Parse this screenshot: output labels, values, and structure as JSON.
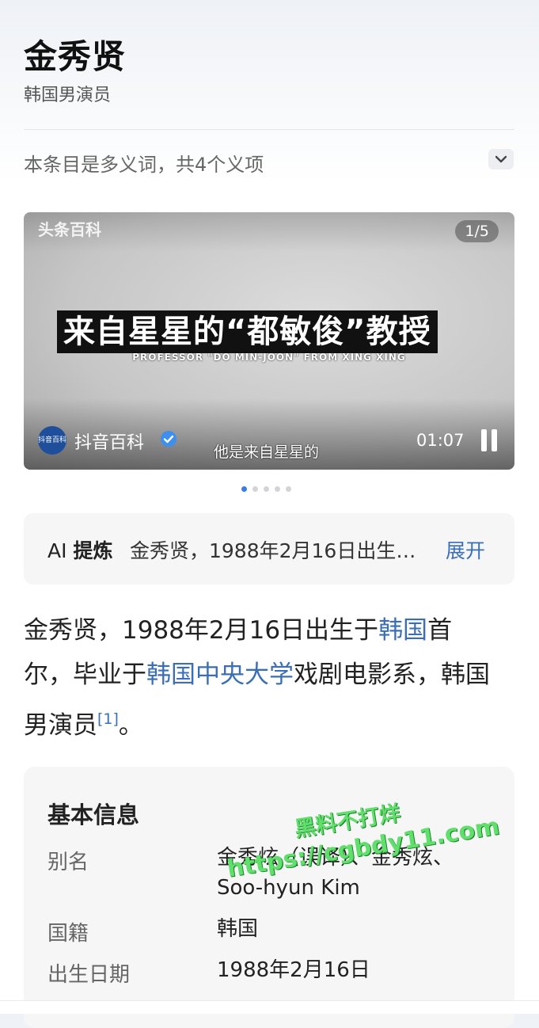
{
  "header": {
    "title": "金秀贤",
    "subtitle": "韩国男演员"
  },
  "disambiguation": {
    "text": "本条目是多义词，共4个义项",
    "toggle_icon": "chevron-down-icon"
  },
  "video": {
    "watermark": "头条百科",
    "counter": "1/5",
    "caption_main": "来自星星的“都敏俊”教授",
    "caption_sub": "PROFESSOR \"DO MIN-JOON\" FROM XING XING",
    "source_logo_text": "抖音百科",
    "source_name": "抖音百科",
    "subtitle_line": "他是来自星星的",
    "time": "01:07",
    "slide_count": 5,
    "active_slide": 1
  },
  "ai_summary": {
    "label_prefix": "AI",
    "label_main": "提炼",
    "text": "金秀贤，1988年2月16日出生…",
    "expand": "展开"
  },
  "summary": {
    "p1": "金秀贤，1988年2月16日出生于",
    "link1": "韩国",
    "p2": "首尔，毕业于",
    "link2": "韩国中央大学",
    "p3": "戏剧电影系，韩国男演员",
    "ref": "[1]",
    "p4": "。"
  },
  "basic_info": {
    "title": "基本信息",
    "rows": [
      {
        "label": "别名",
        "value": "金秀炫（误译）、金秀炫、Soo-hyun Kim"
      },
      {
        "label": "国籍",
        "value": "韩国"
      },
      {
        "label": "出生日期",
        "value": "1988年2月16日"
      }
    ]
  },
  "watermark": {
    "line1": "黑料不打烊",
    "line2": "https://cgbdy11.com"
  },
  "colors": {
    "link": "#3a6fb5",
    "dot_active": "#3b7de8",
    "watermark": "#5fe06a"
  }
}
